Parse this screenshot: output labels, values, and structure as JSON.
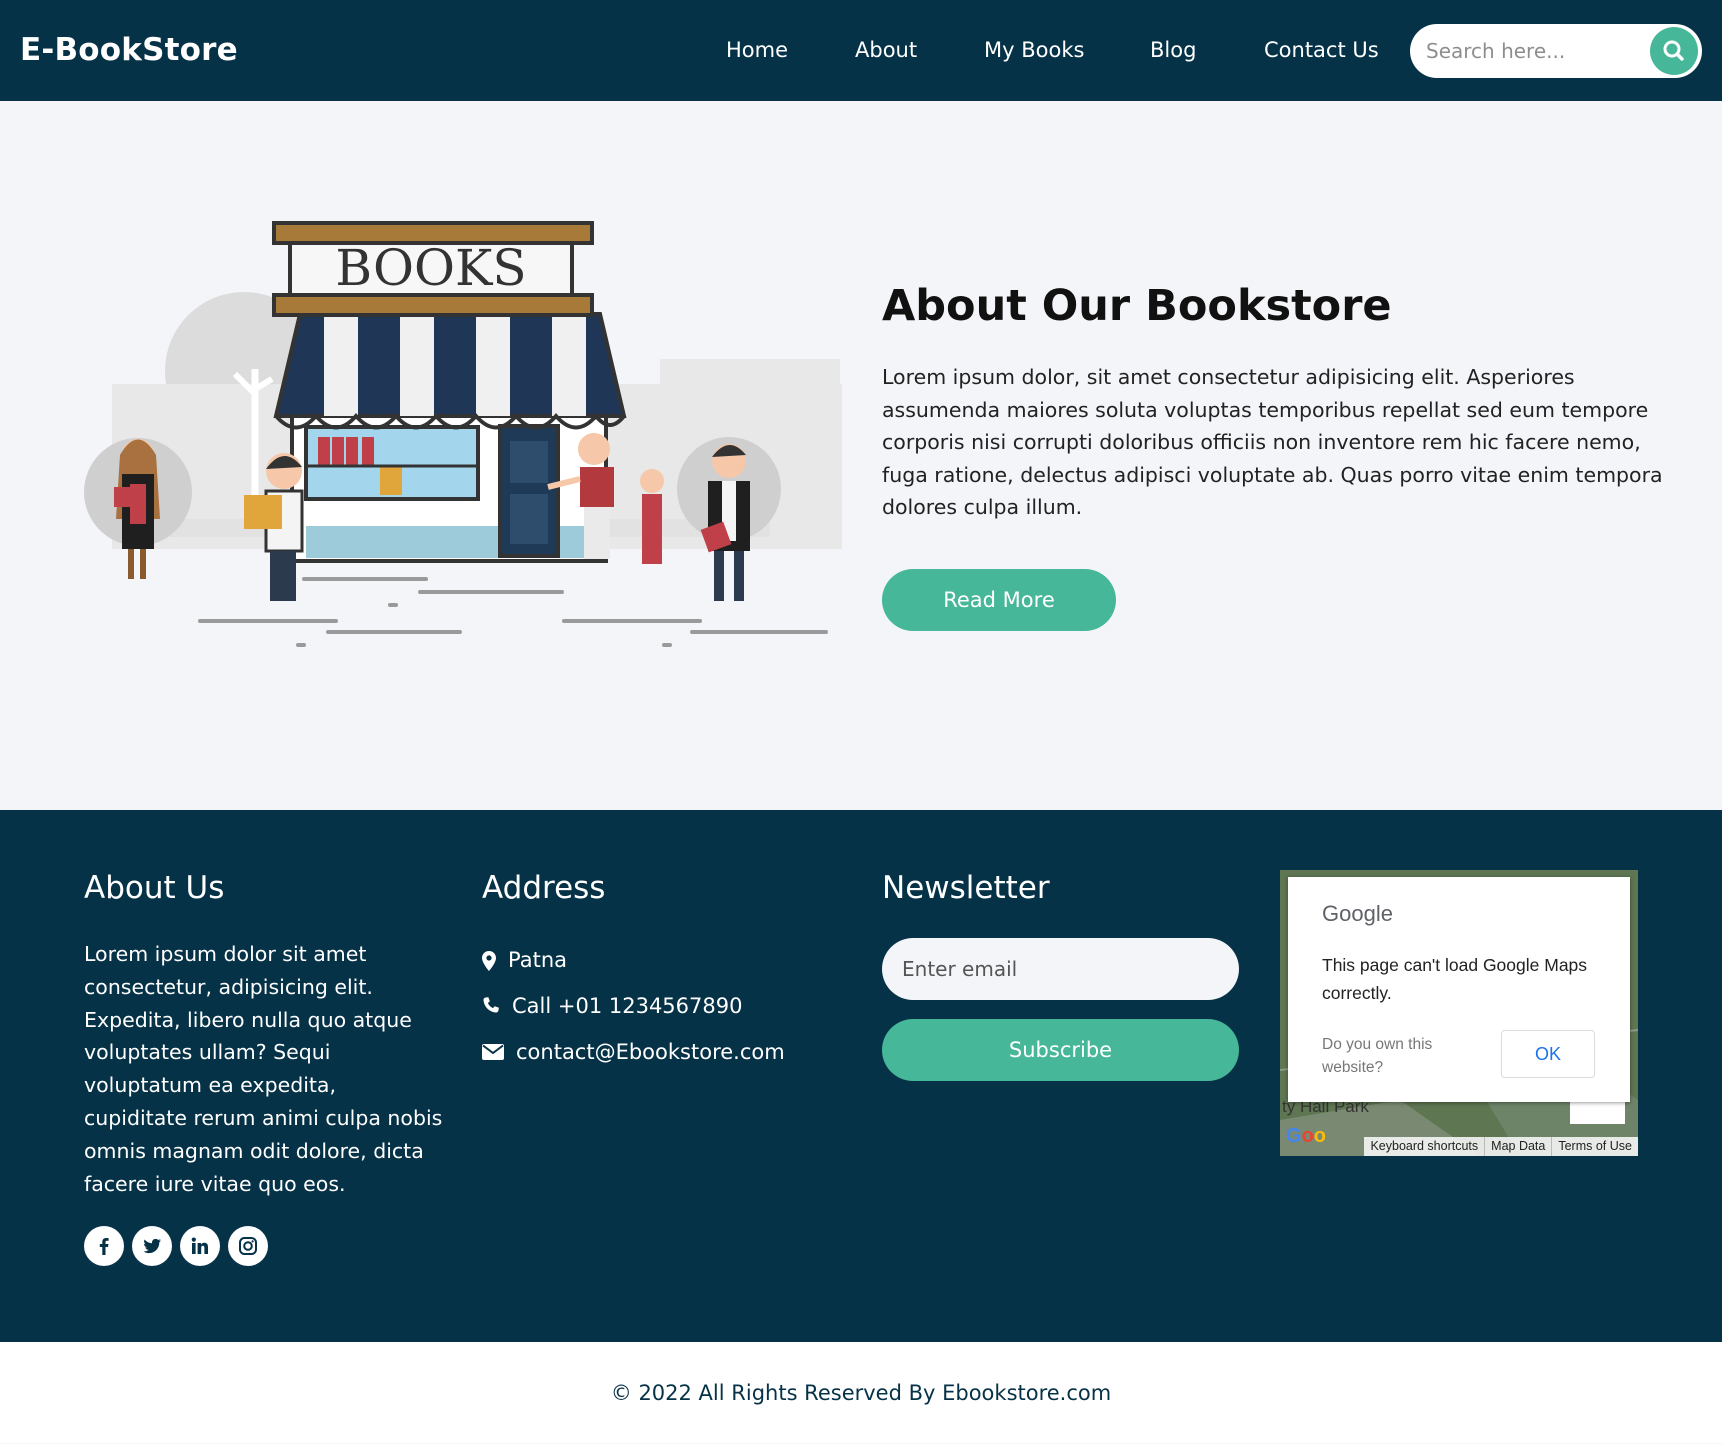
{
  "nav": {
    "brand": "E-BookStore",
    "links": [
      "Home",
      "About",
      "My Books",
      "Blog",
      "Contact Us"
    ],
    "search_placeholder": "Search here...",
    "search_icon": "search-icon"
  },
  "about": {
    "illustration_sign": "BOOKS",
    "title": "About Our Bookstore",
    "text": "Lorem ipsum dolor, sit amet consectetur adipisicing elit. Asperiores assumenda maiores soluta voluptas temporibus repellat sed eum tempore corporis nisi corrupti doloribus officiis non inventore rem hic facere nemo, fuga ratione, delectus adipisci voluptate ab. Quas porro vitae enim tempora dolores culpa illum.",
    "button": "Read More"
  },
  "footer": {
    "about_title": "About Us",
    "about_text": "Lorem ipsum dolor sit amet consectetur, adipisicing elit. Expedita, libero nulla quo atque voluptates ullam? Sequi voluptatum ea expedita, cupiditate rerum animi culpa nobis omnis magnam odit dolore, dicta facere iure vitae quo eos.",
    "socials": [
      "facebook-icon",
      "twitter-icon",
      "linkedin-icon",
      "instagram-icon"
    ],
    "address_title": "Address",
    "address": {
      "city": "Patna",
      "phone": "Call +01 1234567890",
      "email": "contact@Ebookstore.com"
    },
    "newsletter_title": "Newsletter",
    "email_placeholder": "Enter email",
    "subscribe": "Subscribe",
    "map": {
      "logo": "Google",
      "message": "This page can't load Google Maps correctly.",
      "own_question": "Do you own this website?",
      "ok": "OK",
      "place": "ty Hall Park",
      "bar": [
        "Keyboard shortcuts",
        "Map Data",
        "Terms of Use"
      ]
    }
  },
  "copyright": "© 2022 All Rights Reserved By Ebookstore.com",
  "colors": {
    "navy": "#063247",
    "accent": "#46b799",
    "background": "#f4f5f9"
  }
}
